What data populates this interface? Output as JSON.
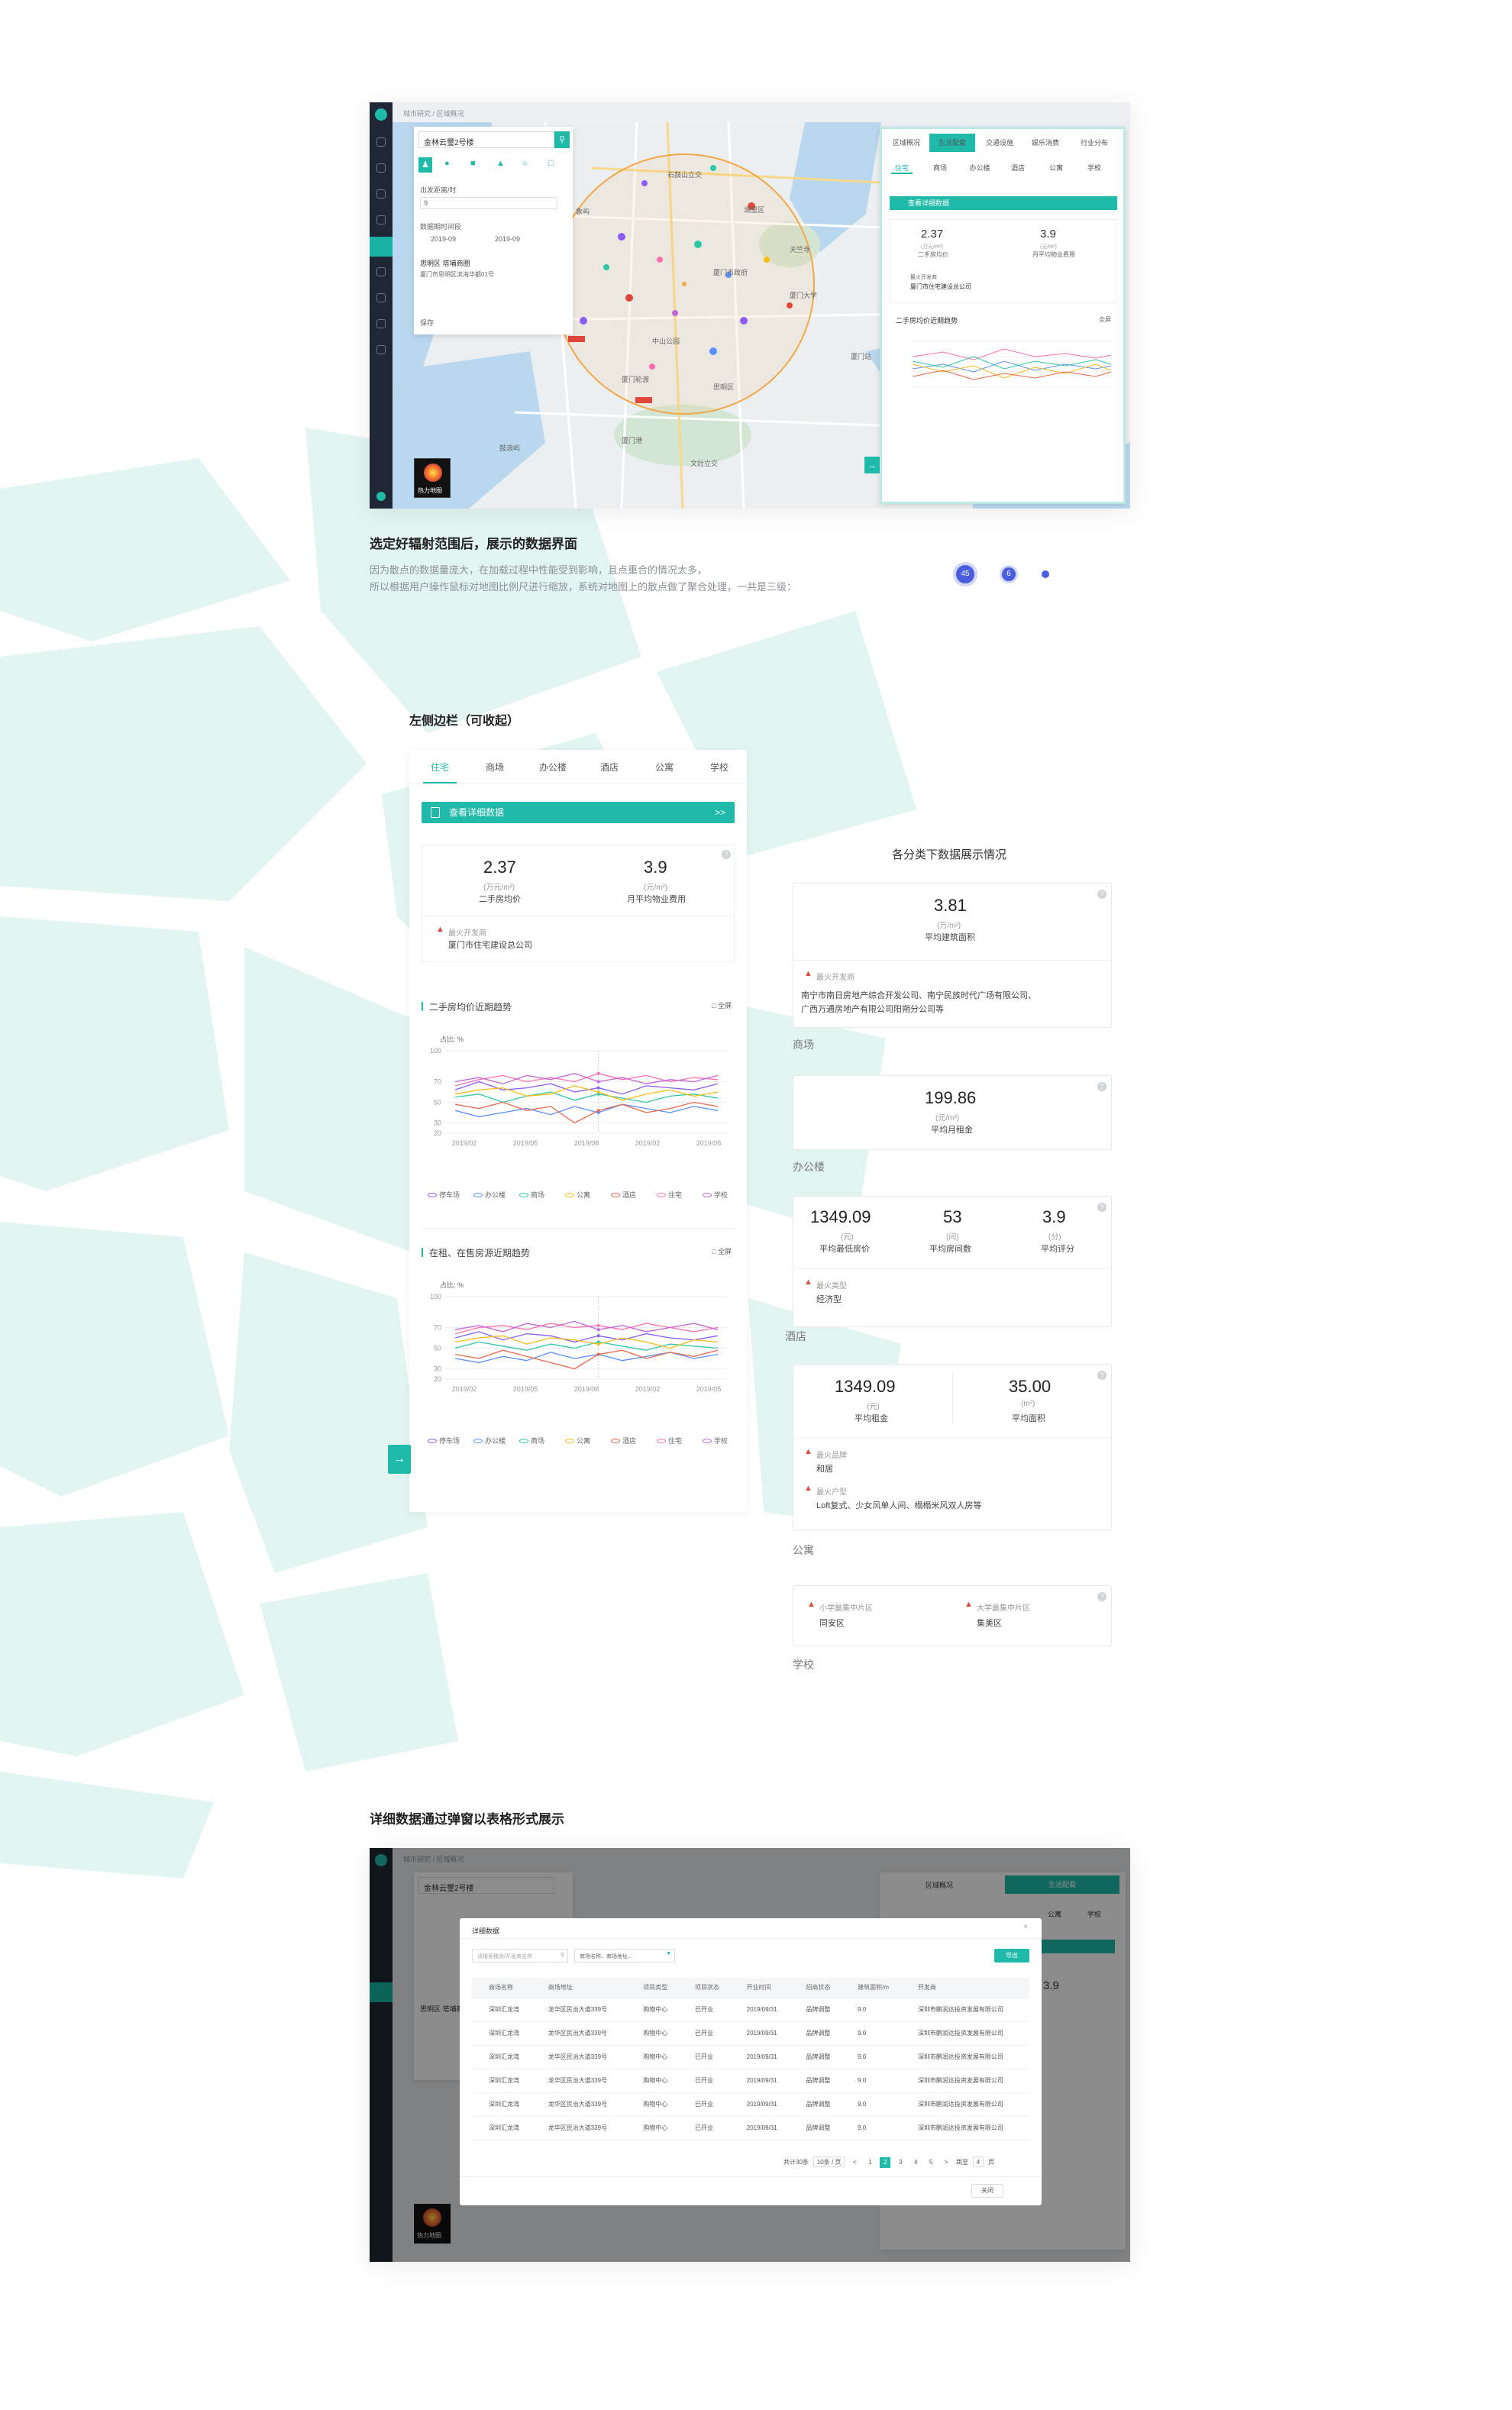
{
  "colors": {
    "accent": "#1fbaa9",
    "sidebar": "#1e2733",
    "fire": "#e0473b",
    "dot_blue": "#4a5de0"
  },
  "top_shot": {
    "breadcrumb": "城市研究 / 区域概况",
    "search_value": "金林云璽2号楼",
    "range_label": "出发距离/时",
    "range_value": "9",
    "time_label": "数据期时间段",
    "date_from": "2019-09",
    "date_to": "2019-09",
    "place_name": "思明区  塔埔商圈",
    "place_addr": "厦门市思明区滨海华都01号",
    "confirm": "保存",
    "heatmap_label": "热力地图",
    "top_tabs": [
      "区域概况",
      "生活配套",
      "交通设施",
      "娱乐消费",
      "行业分布"
    ],
    "sub_tabs": [
      "住宅",
      "商场",
      "办公楼",
      "酒店",
      "公寓",
      "学校"
    ],
    "detail_btn": "查看详细数据",
    "stat1_value": "2.37",
    "stat1_unit": "(万元/m²)",
    "stat1_label": "二手房均价",
    "stat2_value": "3.9",
    "stat2_unit": "(元/m²)",
    "stat2_label": "月平均物业费用",
    "hot_label": "最火开发商",
    "hot_value": "厦门市住宅建设总公司",
    "chart_title": "二手房均价近期趋势",
    "fullscreen": "全屏",
    "map_labels": [
      "石鼓山立交",
      "湖里区",
      "厦门市政府",
      "厦门大学",
      "中山公园",
      "思明区",
      "厦门轮渡",
      "天竺寺",
      "文灶立交",
      "厦门港",
      "鼓浪屿",
      "象屿",
      "厦门站"
    ]
  },
  "intro": {
    "title": "选定好辐射范围后，展示的数据界面",
    "line1": "因为散点的数据量庞大，在加载过程中性能受到影响，且点重合的情况太多，",
    "line2": "所以根据用户操作鼠标对地图比例尺进行缩放，系统对地图上的散点做了聚合处理，一共是三级：",
    "cluster1": "45",
    "cluster2": "6"
  },
  "left_sidebar": {
    "title": "左侧边栏（可收起）",
    "tabs": [
      "住宅",
      "商场",
      "办公楼",
      "酒店",
      "公寓",
      "学校"
    ],
    "detail_btn": "查看详细数据",
    "stat1_value": "2.37",
    "stat1_unit": "(万元/m²)",
    "stat1_label": "二手房均价",
    "stat2_value": "3.9",
    "stat2_unit": "(元/m²)",
    "stat2_label": "月平均物业费用",
    "hot_label": "最火开发商",
    "hot_value": "厦门市住宅建设总公司",
    "chart1_title": "二手房均价近期趋势",
    "chart2_title": "在租、在售房源近期趋势",
    "fullscreen": "全屏",
    "unit_label": "占比: %"
  },
  "chart_data": [
    {
      "type": "line",
      "title": "二手房均价近期趋势",
      "ylabel": "占比: %",
      "ylim": [
        20,
        100
      ],
      "yticks": [
        100,
        70,
        50,
        30,
        20
      ],
      "x": [
        "2019/02",
        "2019/05",
        "2019/08",
        "2019/02",
        "2019/05"
      ],
      "series": [
        {
          "name": "停车场",
          "color": "#8b5cf6",
          "values": [
            62,
            70,
            62,
            64,
            68,
            60,
            64,
            58,
            66,
            64,
            62,
            68
          ]
        },
        {
          "name": "办公楼",
          "color": "#5b8ff9",
          "values": [
            42,
            36,
            40,
            44,
            38,
            46,
            40,
            48,
            44,
            40,
            46,
            42
          ]
        },
        {
          "name": "商场",
          "color": "#2ec7a6",
          "values": [
            55,
            58,
            50,
            56,
            60,
            52,
            58,
            54,
            50,
            56,
            58,
            54
          ]
        },
        {
          "name": "公寓",
          "color": "#f6bd16",
          "values": [
            58,
            62,
            64,
            56,
            58,
            66,
            60,
            52,
            58,
            62,
            56,
            60
          ]
        },
        {
          "name": "酒店",
          "color": "#e8684a",
          "values": [
            48,
            44,
            50,
            42,
            46,
            30,
            42,
            48,
            40,
            44,
            50,
            46
          ]
        },
        {
          "name": "住宅",
          "color": "#ff6fae",
          "values": [
            66,
            72,
            76,
            70,
            74,
            70,
            78,
            72,
            76,
            70,
            74,
            72
          ]
        },
        {
          "name": "学校",
          "color": "#c266d6",
          "values": [
            70,
            74,
            68,
            76,
            72,
            78,
            70,
            74,
            68,
            72,
            70,
            76
          ]
        }
      ]
    },
    {
      "type": "line",
      "title": "在租、在售房源近期趋势",
      "ylabel": "占比: %",
      "ylim": [
        20,
        100
      ],
      "yticks": [
        100,
        70,
        50,
        30,
        20
      ],
      "x": [
        "2019/02",
        "2019/05",
        "2019/08",
        "2019/02",
        "2019/05"
      ],
      "series": [
        {
          "name": "停车场",
          "color": "#8b5cf6",
          "values": [
            60,
            66,
            58,
            64,
            62,
            56,
            62,
            58,
            64,
            60,
            58,
            62
          ]
        },
        {
          "name": "办公楼",
          "color": "#5b8ff9",
          "values": [
            40,
            36,
            42,
            38,
            46,
            40,
            44,
            38,
            42,
            46,
            40,
            44
          ]
        },
        {
          "name": "商场",
          "color": "#2ec7a6",
          "values": [
            50,
            56,
            52,
            48,
            54,
            50,
            56,
            52,
            48,
            54,
            52,
            50
          ]
        },
        {
          "name": "公寓",
          "color": "#f6bd16",
          "values": [
            56,
            60,
            62,
            54,
            60,
            58,
            54,
            60,
            56,
            50,
            58,
            56
          ]
        },
        {
          "name": "酒店",
          "color": "#e8684a",
          "values": [
            44,
            40,
            48,
            42,
            36,
            30,
            44,
            48,
            40,
            46,
            42,
            48
          ]
        },
        {
          "name": "住宅",
          "color": "#ff6fae",
          "values": [
            64,
            70,
            72,
            68,
            74,
            70,
            72,
            68,
            74,
            70,
            66,
            70
          ]
        },
        {
          "name": "学校",
          "color": "#c266d6",
          "values": [
            68,
            72,
            66,
            74,
            70,
            76,
            68,
            72,
            66,
            70,
            74,
            68
          ]
        }
      ]
    }
  ],
  "categories": {
    "title": "各分类下数据展示情况",
    "mall": {
      "name": "商场",
      "value": "3.81",
      "unit": "(万/m²)",
      "label": "平均建筑面积",
      "hot_label": "最火开发商",
      "hot_value": "南宁市南日房地产综合开发公司、南宁民族时代广场有限公司、",
      "hot_value2": "广西万通房地产有限公司阳朔分公司等"
    },
    "office": {
      "name": "办公楼",
      "value": "199.86",
      "unit": "(元/m²)",
      "label": "平均月租金"
    },
    "hotel": {
      "name": "酒店",
      "v1": "1349.09",
      "u1": "(元)",
      "l1": "平均最低房价",
      "v2": "53",
      "u2": "(间)",
      "l2": "平均房间数",
      "v3": "3.9",
      "u3": "(分)",
      "l3": "平均评分",
      "hot_label": "最火类型",
      "hot_value": "经济型"
    },
    "apartment": {
      "name": "公寓",
      "v1": "1349.09",
      "u1": "(元)",
      "l1": "平均租金",
      "v2": "35.00",
      "u2": "(m²)",
      "l2": "平均面积",
      "hot1_label": "最火品牌",
      "hot1_value": "和居",
      "hot2_label": "最火户型",
      "hot2_value": "Loft复式、少女风单人间、榻榻米风双人房等"
    },
    "school": {
      "name": "学校",
      "l1": "小学最集中片区",
      "v1": "同安区",
      "l2": "大学最集中片区",
      "v2": "集美区"
    }
  },
  "modal_section": {
    "title": "详细数据通过弹窗以表格形式展示",
    "modal_title": "详细数据",
    "search_placeholder": "请搜索楼盘/开发商名称",
    "filter_placeholder": "商场名称、商场地址...",
    "export": "导出",
    "close": "关闭",
    "columns": [
      "商场名称",
      "商场地址",
      "项目类型",
      "项目状态",
      "开业时间",
      "招商状态",
      "建筑面积/m",
      "开发商"
    ],
    "rows": [
      [
        "深圳汇龙湾",
        "龙华区民治大道339号",
        "购物中心",
        "已开业",
        "2019/09/31",
        "品牌调整",
        "9.0",
        "深圳市鹏润达投资发展有限公司"
      ],
      [
        "深圳汇龙湾",
        "龙华区民治大道339号",
        "购物中心",
        "已开业",
        "2019/09/31",
        "品牌调整",
        "9.0",
        "深圳市鹏润达投资发展有限公司"
      ],
      [
        "深圳汇龙湾",
        "龙华区民治大道339号",
        "购物中心",
        "已开业",
        "2019/09/31",
        "品牌调整",
        "9.0",
        "深圳市鹏润达投资发展有限公司"
      ],
      [
        "深圳汇龙湾",
        "龙华区民治大道339号",
        "购物中心",
        "已开业",
        "2019/09/31",
        "品牌调整",
        "9.0",
        "深圳市鹏润达投资发展有限公司"
      ],
      [
        "深圳汇龙湾",
        "龙华区民治大道339号",
        "购物中心",
        "已开业",
        "2019/09/31",
        "品牌调整",
        "9.0",
        "深圳市鹏润达投资发展有限公司"
      ],
      [
        "深圳汇龙湾",
        "龙华区民治大道339号",
        "购物中心",
        "已开业",
        "2019/09/31",
        "品牌调整",
        "9.0",
        "深圳市鹏润达投资发展有限公司"
      ]
    ],
    "total": "共计30条",
    "page_size": "10条 / 页",
    "pages": [
      "1",
      "2",
      "3",
      "4",
      "5"
    ],
    "jump_label": "跳至",
    "jump_value": "4",
    "jump_suffix": "页",
    "bg_tabs": [
      "区域概况",
      "生活配套"
    ],
    "bg_subtabs": [
      "公寓",
      "学校"
    ],
    "bg_stat": "3.9"
  }
}
